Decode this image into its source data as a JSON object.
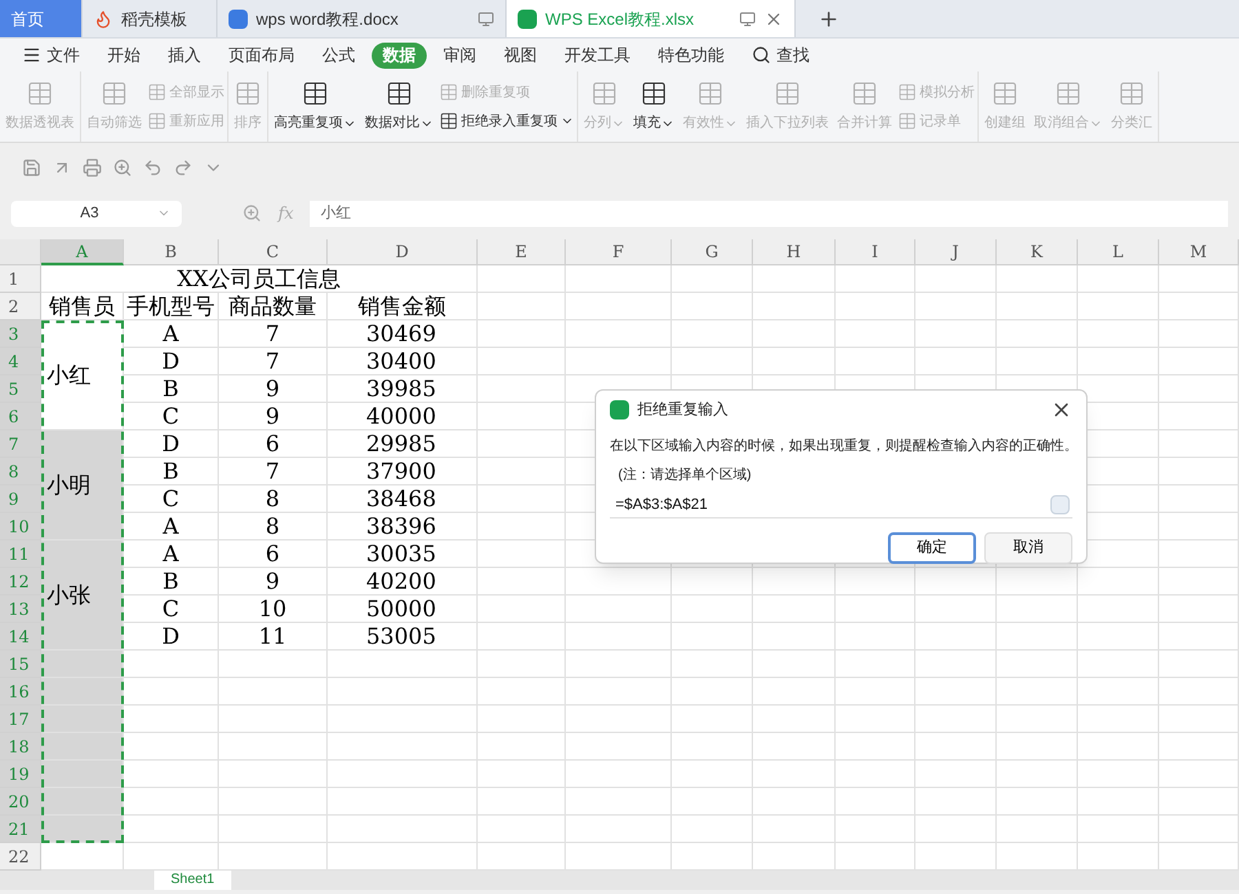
{
  "tabs": [
    {
      "label": "首页",
      "kind": "home",
      "selected": false
    },
    {
      "label": "稻壳模板",
      "kind": "docer",
      "selected": false
    },
    {
      "label": "wps word教程.docx",
      "kind": "word",
      "selected": false
    },
    {
      "label": "WPS Excel教程.xlsx",
      "kind": "excel",
      "selected": true
    }
  ],
  "menu": [
    {
      "label": "文件",
      "kind": "file",
      "selected": false
    },
    {
      "label": "开始",
      "kind": "plain",
      "selected": false
    },
    {
      "label": "插入",
      "kind": "plain",
      "selected": false
    },
    {
      "label": "页面布局",
      "kind": "plain",
      "selected": false
    },
    {
      "label": "公式",
      "kind": "plain",
      "selected": false
    },
    {
      "label": "数据",
      "kind": "plain",
      "selected": true
    },
    {
      "label": "审阅",
      "kind": "plain",
      "selected": false
    },
    {
      "label": "视图",
      "kind": "plain",
      "selected": false
    },
    {
      "label": "开发工具",
      "kind": "plain",
      "selected": false
    },
    {
      "label": "特色功能",
      "kind": "plain",
      "selected": false
    },
    {
      "label": "查找",
      "kind": "search",
      "selected": false
    }
  ],
  "ribbon": [
    [
      {
        "kind": "large",
        "label": "数据透视表",
        "disabled": true,
        "dropdown": false
      }
    ],
    [
      {
        "kind": "large",
        "label": "自动筛选",
        "disabled": true,
        "dropdown": false
      },
      {
        "kind": "small",
        "items": [
          {
            "label": "全部显示",
            "disabled": true,
            "dropdown": false
          },
          {
            "label": "重新应用",
            "disabled": true,
            "dropdown": false
          }
        ]
      }
    ],
    [
      {
        "kind": "large",
        "label": "排序",
        "disabled": true,
        "dropdown": false
      }
    ],
    [
      {
        "kind": "large",
        "label": "高亮重复项",
        "disabled": false,
        "dropdown": true
      },
      {
        "kind": "large",
        "label": "数据对比",
        "disabled": false,
        "dropdown": true
      },
      {
        "kind": "small",
        "items": [
          {
            "label": "删除重复项",
            "disabled": true,
            "dropdown": false
          },
          {
            "label": "拒绝录入重复项",
            "disabled": false,
            "dropdown": true
          }
        ]
      }
    ],
    [
      {
        "kind": "large",
        "label": "分列",
        "disabled": true,
        "dropdown": true
      },
      {
        "kind": "large",
        "label": "填充",
        "disabled": false,
        "dropdown": true
      },
      {
        "kind": "large",
        "label": "有效性",
        "disabled": true,
        "dropdown": true
      },
      {
        "kind": "large",
        "label": "插入下拉列表",
        "disabled": true,
        "dropdown": false
      },
      {
        "kind": "large",
        "label": "合并计算",
        "disabled": true,
        "dropdown": false
      },
      {
        "kind": "small",
        "items": [
          {
            "label": "模拟分析",
            "disabled": true,
            "dropdown": false
          },
          {
            "label": "记录单",
            "disabled": true,
            "dropdown": false
          }
        ]
      }
    ],
    [
      {
        "kind": "large",
        "label": "创建组",
        "disabled": true,
        "dropdown": false
      },
      {
        "kind": "large",
        "label": "取消组合",
        "disabled": true,
        "dropdown": true
      },
      {
        "kind": "large",
        "label": "分类汇",
        "disabled": true,
        "dropdown": false
      }
    ]
  ],
  "name_box": "A3",
  "function_label": "fx",
  "formula": "小红",
  "columns": [
    {
      "label": "A",
      "selected": true
    },
    {
      "label": "B",
      "selected": false
    },
    {
      "label": "C",
      "selected": false
    },
    {
      "label": "D",
      "selected": false
    },
    {
      "label": "E",
      "selected": false
    },
    {
      "label": "F",
      "selected": false
    },
    {
      "label": "G",
      "selected": false
    },
    {
      "label": "H",
      "selected": false
    },
    {
      "label": "I",
      "selected": false
    },
    {
      "label": "J",
      "selected": false
    },
    {
      "label": "K",
      "selected": false
    },
    {
      "label": "L",
      "selected": false
    },
    {
      "label": "M",
      "selected": false
    }
  ],
  "row_numbers": [
    {
      "label": "1",
      "selected": false
    },
    {
      "label": "2",
      "selected": false
    },
    {
      "label": "3",
      "selected": true
    },
    {
      "label": "4",
      "selected": true
    },
    {
      "label": "5",
      "selected": true
    },
    {
      "label": "6",
      "selected": true
    },
    {
      "label": "7",
      "selected": true
    },
    {
      "label": "8",
      "selected": true
    },
    {
      "label": "9",
      "selected": true
    },
    {
      "label": "10",
      "selected": true
    },
    {
      "label": "11",
      "selected": true
    },
    {
      "label": "12",
      "selected": true
    },
    {
      "label": "13",
      "selected": true
    },
    {
      "label": "14",
      "selected": true
    },
    {
      "label": "15",
      "selected": true
    },
    {
      "label": "16",
      "selected": true
    },
    {
      "label": "17",
      "selected": true
    },
    {
      "label": "18",
      "selected": true
    },
    {
      "label": "19",
      "selected": true
    },
    {
      "label": "20",
      "selected": true
    },
    {
      "label": "21",
      "selected": true
    },
    {
      "label": "22",
      "selected": false
    }
  ],
  "title": "XX公司员工信息",
  "headers": [
    "销售员",
    "手机型号",
    "商品数量",
    "销售金额"
  ],
  "groups": [
    {
      "name": "小红",
      "active": true,
      "rows": [
        [
          "A",
          "7",
          "30469"
        ],
        [
          "D",
          "7",
          "30400"
        ],
        [
          "B",
          "9",
          "39985"
        ],
        [
          "C",
          "9",
          "40000"
        ]
      ]
    },
    {
      "name": "小明",
      "active": false,
      "rows": [
        [
          "D",
          "6",
          "29985"
        ],
        [
          "B",
          "7",
          "37900"
        ],
        [
          "C",
          "8",
          "38468"
        ],
        [
          "A",
          "8",
          "38396"
        ]
      ]
    },
    {
      "name": "小张",
      "active": false,
      "rows": [
        [
          "A",
          "6",
          "30035"
        ],
        [
          "B",
          "9",
          "40200"
        ],
        [
          "C",
          "10",
          "50000"
        ],
        [
          "D",
          "11",
          "53005"
        ]
      ]
    }
  ],
  "sheet_tabs": [
    {
      "label": "Sheet1",
      "selected": true
    }
  ],
  "dialog": {
    "title": "拒绝重复输入",
    "message": "在以下区域输入内容的时候，如果出现重复，则提醒检查输入内容的正确性。",
    "note": "(注：请选择单个区域)",
    "value": "=$A$3:$A$21",
    "buttons": [
      {
        "label": "确定",
        "primary": true
      },
      {
        "label": "取消",
        "primary": false
      }
    ]
  }
}
